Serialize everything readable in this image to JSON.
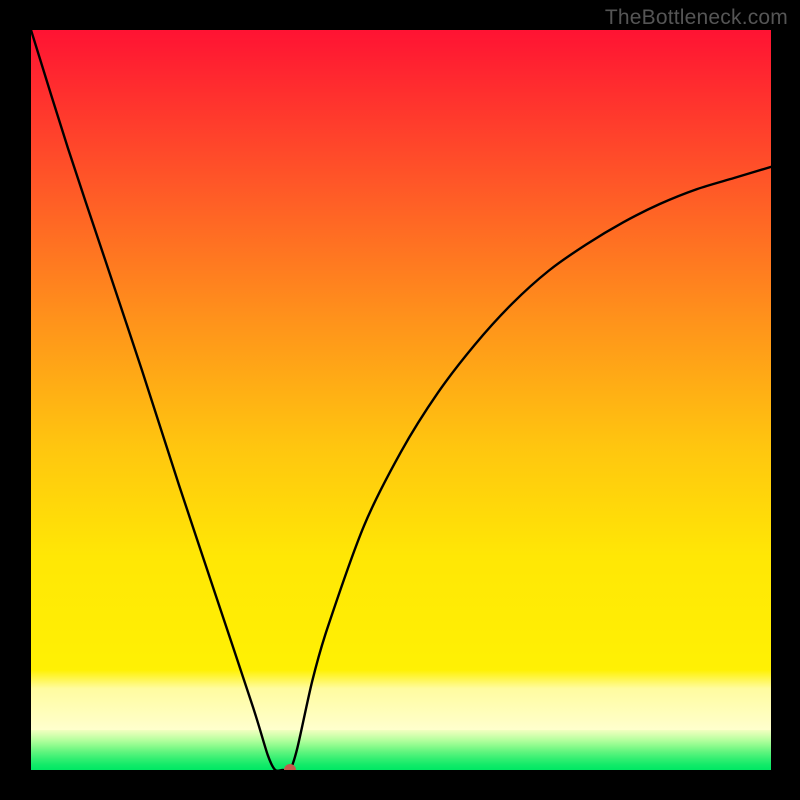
{
  "watermark": {
    "text": "TheBottleneck.com"
  },
  "chart_data": {
    "type": "line",
    "title": "",
    "xlabel": "",
    "ylabel": "",
    "xlim": [
      0,
      100
    ],
    "ylim": [
      0,
      100
    ],
    "grid": false,
    "series": [
      {
        "name": "bottleneck-curve",
        "x": [
          0,
          5,
          10,
          15,
          20,
          25,
          30,
          32,
          33,
          34,
          35,
          36,
          38,
          40,
          45,
          50,
          55,
          60,
          65,
          70,
          75,
          80,
          85,
          90,
          95,
          100
        ],
        "values": [
          100,
          84,
          69,
          54,
          38.5,
          23.5,
          8.5,
          2,
          0,
          0,
          0,
          3,
          12,
          19,
          33,
          43,
          51,
          57.5,
          63,
          67.5,
          71,
          74,
          76.5,
          78.5,
          80,
          81.5
        ]
      }
    ],
    "optimal_point": {
      "x": 35,
      "y": 0
    },
    "background_gradient": {
      "top_color": "#ff1434",
      "mid_color": "#ffe705",
      "low_band_color": "#ffffc8",
      "bottom_color": "#00e864"
    }
  }
}
